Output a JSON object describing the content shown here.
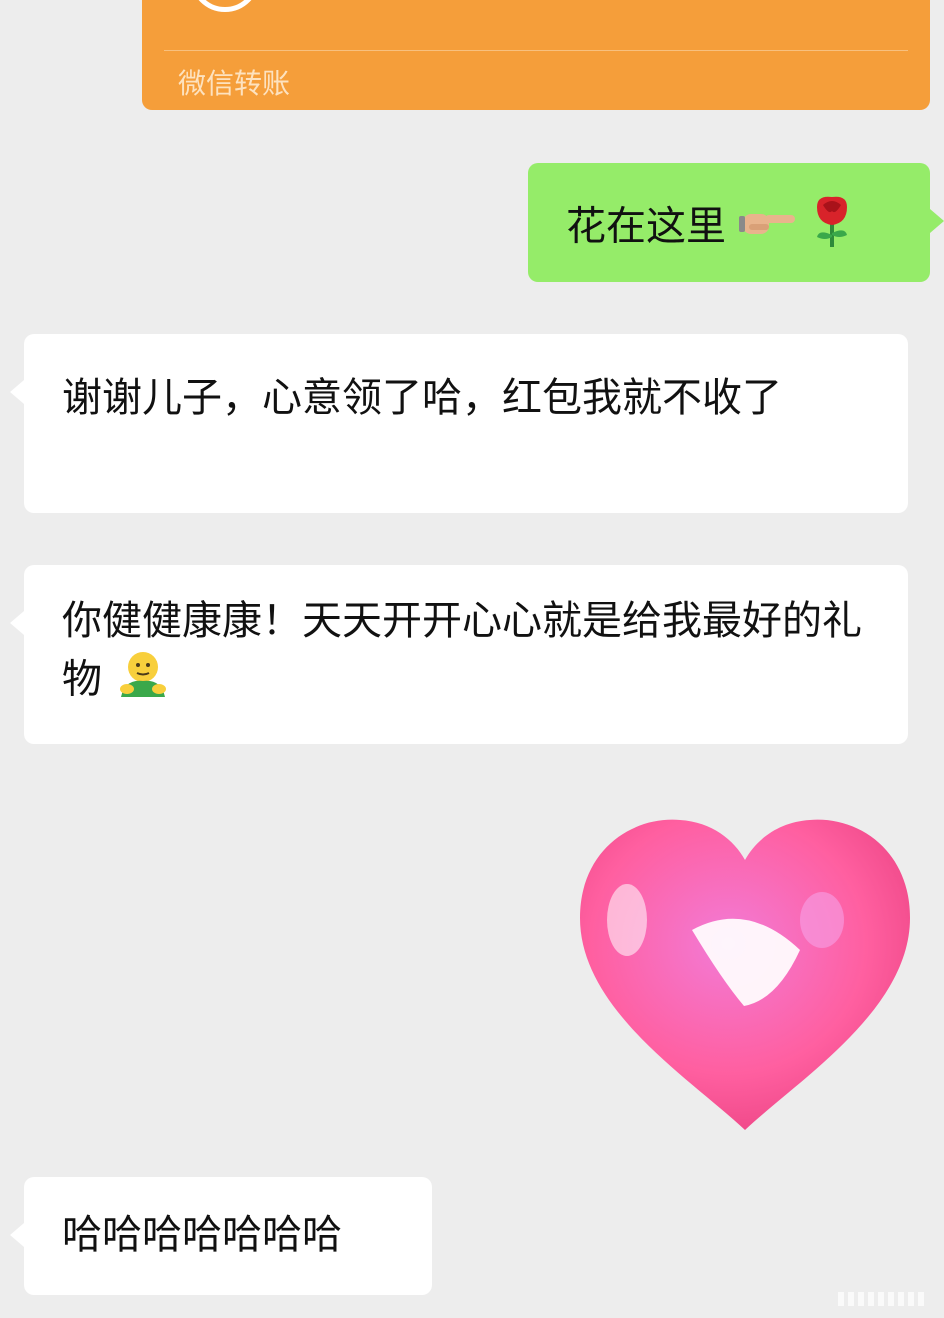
{
  "transfer": {
    "label": "微信转账",
    "color": "#f59e3a"
  },
  "messages": [
    {
      "side": "right",
      "text": "花在这里",
      "trailing_icons": [
        "pointing-hand-icon",
        "rose-icon"
      ]
    },
    {
      "side": "left",
      "text": "谢谢儿子，心意领了哈，红包我就不收了"
    },
    {
      "side": "left",
      "text": "你健健康康！天天开开心心就是给我最好的礼物",
      "trailing_icons": [
        "hug-emoji-icon"
      ]
    },
    {
      "side": "left",
      "type": "sticker",
      "icon": "pink-heart-sticker-icon"
    },
    {
      "side": "left",
      "text": "哈哈哈哈哈哈哈"
    }
  ],
  "colors": {
    "background": "#ededed",
    "sent_bubble": "#95ec69",
    "received_bubble": "#ffffff",
    "heart": "#ff5c9c"
  }
}
